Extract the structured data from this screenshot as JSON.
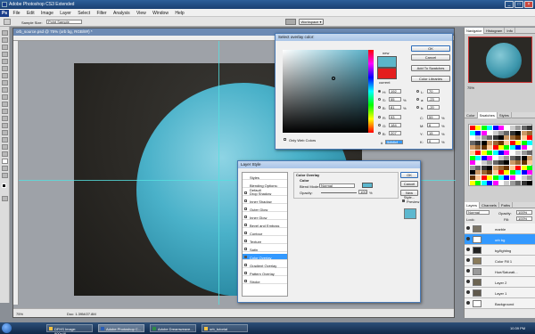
{
  "window": {
    "title": "Adobe Photoshop CS3 Extended"
  },
  "menu": [
    "File",
    "Edit",
    "Image",
    "Layer",
    "Select",
    "Filter",
    "Analysis",
    "View",
    "Window",
    "Help"
  ],
  "options": {
    "sample_size_label": "Sample Size:",
    "sample_size_value": "Point Sample",
    "workspace": "Workspace ▾"
  },
  "document": {
    "title": "orb_source.psd @ 75% (orb bg, RGB/8#) *",
    "zoom": "75%",
    "doc_info": "Doc: 1.39M/27.8M"
  },
  "navigator": {
    "tabs": [
      "Navigator",
      "Histogram",
      "Info"
    ],
    "zoom": "75%"
  },
  "swatches_tabs": [
    "Color",
    "Swatches",
    "Styles"
  ],
  "layers": {
    "tabs": [
      "Layers",
      "Channels",
      "Paths"
    ],
    "blend_mode": "Normal",
    "opacity_label": "Opacity:",
    "opacity": "100%",
    "lock_label": "Lock:",
    "fill_label": "Fill:",
    "fill": "100%",
    "items": [
      {
        "name": "marble",
        "selected": false,
        "thumb": "#7b7466"
      },
      {
        "name": "orb bg",
        "selected": true,
        "thumb": "#ffffff"
      },
      {
        "name": "bg/lighting",
        "selected": false,
        "thumb": "#222222"
      },
      {
        "name": "Color Fill 1",
        "selected": false,
        "thumb": "#8a7b5a"
      },
      {
        "name": "Hue/Saturati...",
        "selected": false,
        "thumb": "#999999"
      },
      {
        "name": "Layer 2",
        "selected": false,
        "thumb": "#6d6552"
      },
      {
        "name": "Layer 1",
        "selected": false,
        "thumb": "#5f584c"
      },
      {
        "name": "Background",
        "selected": false,
        "thumb": "#ffffff"
      }
    ]
  },
  "color_picker": {
    "title": "Select overlay color:",
    "buttons": {
      "ok": "OK",
      "cancel": "Cancel",
      "add_swatches": "Add To Swatches",
      "libraries": "Color Libraries"
    },
    "new_label": "new",
    "current_label": "current",
    "only_web": "Only Web Colors",
    "H": "192",
    "S": "55",
    "B": "81",
    "R": "93",
    "G": "184",
    "Bl": "207",
    "L": "70",
    "a": "-23",
    "b": "-20",
    "C": "59",
    "M": "6",
    "Y": "15",
    "K": "0",
    "hex": "5db8cf",
    "pct": "%"
  },
  "layer_style": {
    "title": "Layer Style",
    "styles": [
      "Styles",
      "Blending Options: Default",
      "Drop Shadow",
      "Inner Shadow",
      "Outer Glow",
      "Inner Glow",
      "Bevel and Emboss",
      "Contour",
      "Texture",
      "Satin",
      "Color Overlay",
      "Gradient Overlay",
      "Pattern Overlay",
      "Stroke"
    ],
    "selected": "Color Overlay",
    "section": "Color Overlay",
    "subsection": "Color",
    "blend_label": "Blend Mode:",
    "blend_value": "Normal",
    "opacity_label": "Opacity:",
    "opacity_value": "100",
    "pct": "%",
    "overlay_color": "#5db8cf",
    "buttons": {
      "ok": "OK",
      "cancel": "Cancel",
      "new_style": "New Style...",
      "preview": "Preview"
    }
  },
  "taskbar": {
    "items": [
      "DFHS Image: 900x46...",
      "Adobe Photoshop C...",
      "Adobe Dreamweave...",
      "orb_tutorial"
    ],
    "clock": "10:39 PM"
  }
}
